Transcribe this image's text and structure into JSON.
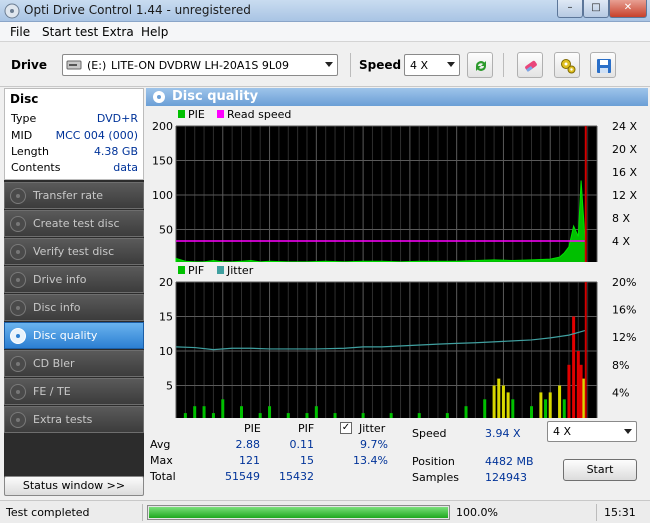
{
  "window": {
    "title": "Opti Drive Control 1.44 - unregistered",
    "minimize": "–",
    "maximize": "□",
    "close": "✕"
  },
  "menu": [
    "File",
    "Start test",
    "Extra",
    "Help"
  ],
  "toolbar": {
    "drive_label": "Drive",
    "drive_letter": "(E:)",
    "drive_name": "LITE-ON DVDRW LH-20A1S 9L09",
    "speed_label": "Speed",
    "speed_value": "4 X"
  },
  "disc": {
    "title": "Disc",
    "rows": [
      {
        "key": "Type",
        "value": "DVD+R"
      },
      {
        "key": "MID",
        "value": "MCC 004 (000)"
      },
      {
        "key": "Length",
        "value": "4.38 GB"
      },
      {
        "key": "Contents",
        "value": "data"
      }
    ]
  },
  "nav": [
    {
      "label": "Transfer rate",
      "active": false
    },
    {
      "label": "Create test disc",
      "active": false
    },
    {
      "label": "Verify test disc",
      "active": false
    },
    {
      "label": "Drive info",
      "active": false
    },
    {
      "label": "Disc info",
      "active": false
    },
    {
      "label": "Disc quality",
      "active": true
    },
    {
      "label": "CD Bler",
      "active": false
    },
    {
      "label": "FE / TE",
      "active": false
    },
    {
      "label": "Extra tests",
      "active": false
    }
  ],
  "status_window_label": "Status window >>",
  "panel": {
    "title": "Disc quality"
  },
  "chart_data": [
    {
      "type": "area",
      "legend": [
        {
          "name": "PIE",
          "color": "#00c000"
        },
        {
          "name": "Read speed",
          "color": "#ff00ff"
        }
      ],
      "x_ticks": [
        "0.0",
        "0.5",
        "1.0",
        "1.5",
        "2.0",
        "2.5",
        "3.0",
        "3.5",
        "4.0",
        "4.5 GB"
      ],
      "xlim": [
        0,
        4.5
      ],
      "y_left_ticks": [
        "200",
        "150",
        "100",
        "50"
      ],
      "ylim_left": [
        0,
        200
      ],
      "y_right_ticks": [
        "24 X",
        "20 X",
        "16 X",
        "12 X",
        "8 X",
        "4 X"
      ],
      "ylim_right": [
        0,
        24
      ],
      "grid": true,
      "series": [
        {
          "name": "PIE",
          "x": [
            0.0,
            0.1,
            0.2,
            0.3,
            0.4,
            0.5,
            0.6,
            0.7,
            0.8,
            0.9,
            1.0,
            1.2,
            1.4,
            1.6,
            1.8,
            2.0,
            2.2,
            2.4,
            2.6,
            2.8,
            3.0,
            3.2,
            3.4,
            3.6,
            3.8,
            4.0,
            4.1,
            4.15,
            4.2,
            4.25,
            4.3,
            4.33,
            4.36,
            4.38
          ],
          "values": [
            8,
            4,
            3,
            3,
            5,
            3,
            3,
            4,
            5,
            3,
            4,
            3,
            3,
            4,
            3,
            4,
            4,
            3,
            4,
            4,
            4,
            5,
            6,
            5,
            6,
            7,
            10,
            16,
            25,
            55,
            40,
            121,
            60,
            20
          ]
        },
        {
          "name": "Read speed",
          "x": [
            0.0,
            4.38
          ],
          "values": [
            4,
            4
          ]
        }
      ],
      "marker_x": 4.38
    },
    {
      "type": "bar",
      "legend": [
        {
          "name": "PIF",
          "color": "#00c000"
        },
        {
          "name": "Jitter",
          "color": "#40a0a0"
        }
      ],
      "x_ticks": [
        "0.0",
        "0.5",
        "1.0",
        "1.5",
        "2.0",
        "2.5",
        "3.0",
        "3.5",
        "4.0",
        "4.5 GB"
      ],
      "xlim": [
        0,
        4.5
      ],
      "y_left_ticks": [
        "20",
        "15",
        "10",
        "5"
      ],
      "ylim_left": [
        0,
        20
      ],
      "y_right_ticks": [
        "20%",
        "16%",
        "12%",
        "8%",
        "4%"
      ],
      "ylim_right": [
        0,
        20
      ],
      "grid": true,
      "series": [
        {
          "name": "PIF",
          "x": [
            0.1,
            0.2,
            0.3,
            0.4,
            0.5,
            0.7,
            0.9,
            1.0,
            1.2,
            1.4,
            1.5,
            1.7,
            2.0,
            2.3,
            2.6,
            2.9,
            3.1,
            3.3,
            3.4,
            3.45,
            3.5,
            3.55,
            3.6,
            3.8,
            3.9,
            3.95,
            4.0,
            4.1,
            4.15,
            4.2,
            4.25,
            4.3,
            4.33,
            4.36
          ],
          "values": [
            1,
            2,
            2,
            1,
            3,
            2,
            1,
            2,
            1,
            1,
            2,
            1,
            1,
            1,
            1,
            1,
            2,
            3,
            5,
            6,
            5,
            4,
            3,
            2,
            4,
            3,
            4,
            5,
            3,
            8,
            15,
            10,
            8,
            6
          ]
        },
        {
          "name": "Jitter",
          "x": [
            0.0,
            0.2,
            0.4,
            0.6,
            0.8,
            1.0,
            1.2,
            1.5,
            1.8,
            2.0,
            2.2,
            2.5,
            2.8,
            3.0,
            3.2,
            3.5,
            3.8,
            4.0,
            4.2,
            4.38
          ],
          "values": [
            10.6,
            10.5,
            10.2,
            10.4,
            10.4,
            10.3,
            10.3,
            10.3,
            10.4,
            10.6,
            10.6,
            10.8,
            11.0,
            11.1,
            11.2,
            11.4,
            11.6,
            11.9,
            12.3,
            13.0
          ]
        }
      ],
      "marker_x": 4.38
    }
  ],
  "stats": {
    "headers": {
      "pie": "PIE",
      "pif": "PIF",
      "jitter": "Jitter"
    },
    "rows": [
      {
        "label": "Avg",
        "pie": "2.88",
        "pif": "0.11",
        "jitter": "9.7%"
      },
      {
        "label": "Max",
        "pie": "121",
        "pif": "15",
        "jitter": "13.4%"
      },
      {
        "label": "Total",
        "pie": "51549",
        "pif": "15432",
        "jitter": ""
      }
    ],
    "jitter_checked": "✓",
    "speed_label": "Speed",
    "speed_value": "3.94 X",
    "position_label": "Position",
    "position_value": "4482 MB",
    "samples_label": "Samples",
    "samples_value": "124943",
    "speed_select": "4 X",
    "start_label": "Start"
  },
  "status": {
    "text": "Test completed",
    "progress_pct": 100,
    "progress_label": "100.0%",
    "elapsed": "15:31"
  }
}
